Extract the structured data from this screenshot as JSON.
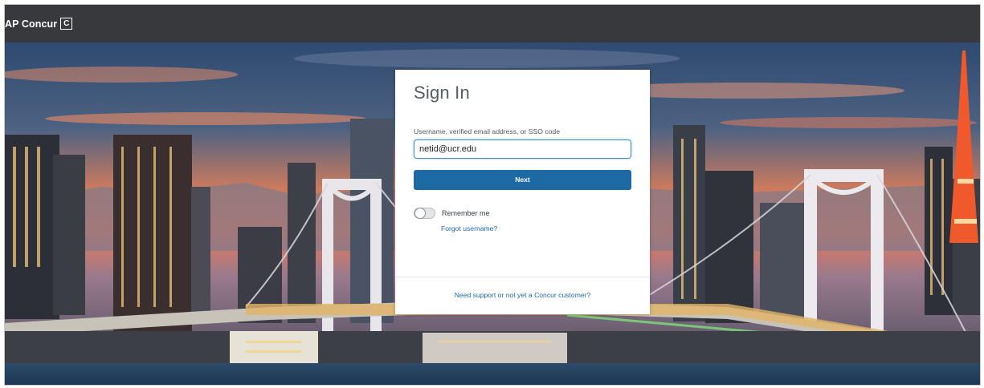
{
  "header": {
    "brand_text": "AP Concur",
    "brand_mark": "C",
    "background_color": "#37393d"
  },
  "signin": {
    "title": "Sign In",
    "field_label": "Username, verified email address, or SSO code",
    "field_value": "netid@ucr.edu",
    "next_label": "Next",
    "remember_label": "Remember me",
    "remember_checked": false,
    "forgot_label": "Forgot username?",
    "support_label": "Need support or not yet a Concur customer?"
  },
  "colors": {
    "accent": "#1c69a4",
    "input_focus": "#3d8fcc"
  },
  "background": {
    "description_icon": "city-skyline-image"
  }
}
